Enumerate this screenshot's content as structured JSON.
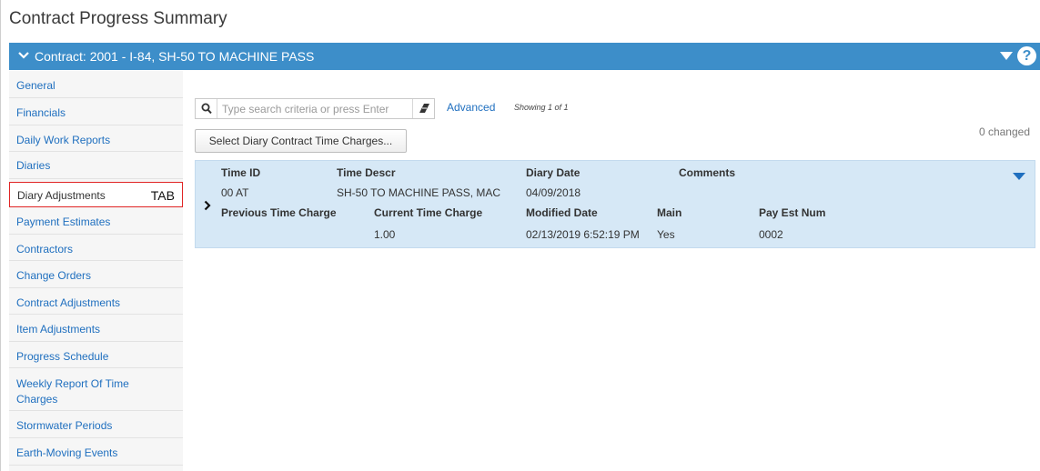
{
  "page": {
    "title": "Contract Progress Summary"
  },
  "contract_bar": {
    "title": "Contract: 2001 - I-84, SH-50 TO MACHINE PASS",
    "help_label": "?"
  },
  "sidebar": {
    "items": [
      {
        "label": "General"
      },
      {
        "label": "Financials"
      },
      {
        "label": "Daily Work Reports"
      },
      {
        "label": "Diaries"
      },
      {
        "label": "Diary Adjustments",
        "active": true,
        "marker": "TAB"
      },
      {
        "label": "Payment Estimates"
      },
      {
        "label": "Contractors"
      },
      {
        "label": "Change Orders"
      },
      {
        "label": "Contract Adjustments"
      },
      {
        "label": "Item Adjustments"
      },
      {
        "label": "Progress Schedule"
      },
      {
        "label": "Weekly Report Of Time Charges"
      },
      {
        "label": "Stormwater Periods"
      },
      {
        "label": "Earth-Moving Events"
      }
    ]
  },
  "search": {
    "placeholder": "Type search criteria or press Enter",
    "advanced_label": "Advanced",
    "showing_text": "Showing 1 of 1"
  },
  "changed_text": "0 changed",
  "select_button_label": "Select Diary Contract Time Charges...",
  "record": {
    "labels": {
      "time_id": "Time ID",
      "time_descr": "Time Descr",
      "diary_date": "Diary Date",
      "comments": "Comments",
      "previous_time_charge": "Previous Time Charge",
      "current_time_charge": "Current Time Charge",
      "modified_date": "Modified Date",
      "main": "Main",
      "pay_est_num": "Pay Est Num"
    },
    "values": {
      "time_id": "00 AT",
      "time_descr": "SH-50 TO MACHINE PASS, MAC",
      "diary_date": "04/09/2018",
      "comments": "",
      "previous_time_charge": "",
      "current_time_charge": "1.00",
      "modified_date": "02/13/2019 6:52:19 PM",
      "main": "Yes",
      "pay_est_num": "0002"
    }
  },
  "colors": {
    "header_blue": "#3d8ec9",
    "link_blue": "#1f6fbf",
    "record_bg": "#d6e8f6",
    "active_border": "#e02424"
  },
  "icons": [
    "chevron-down-icon",
    "caret-down-icon",
    "help-icon",
    "search-icon",
    "eraser-icon",
    "chevron-right-icon"
  ]
}
